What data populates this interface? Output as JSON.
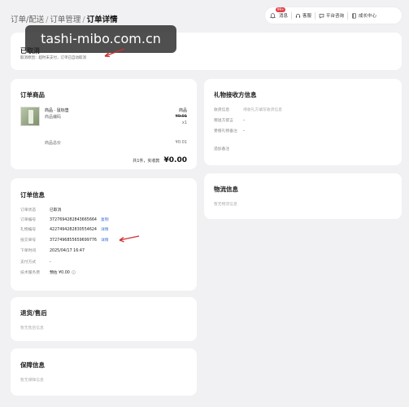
{
  "watermark": "tashi-mibo.com.cn",
  "breadcrumb": {
    "item1": "订单/配送",
    "item2": "订单管理",
    "current": "订单详情"
  },
  "topbar": {
    "bell_badge": "99+",
    "bell_label": "消息",
    "service_label": "客服",
    "consult_label": "平台咨询",
    "growth_label": "成长中心"
  },
  "status": {
    "title": "已取消",
    "note": "取消原因：超时未支付，订单已自动取消"
  },
  "product": {
    "section_title": "订单商品",
    "name": "商品 · 鼠标垫",
    "code_label": "商品编码",
    "price_label": "商品",
    "price": "¥0.01",
    "qty": "x1",
    "total_label": "商品总价",
    "total": "¥0.01",
    "summary_prefix": "共1件，实收款",
    "summary_amount": "¥0.00"
  },
  "gift": {
    "section_title": "礼物接收方信息",
    "rows": [
      {
        "key": "收货信息",
        "value": "待收礼方填写收货信息"
      },
      {
        "key": "赠送方留言",
        "value": "-"
      },
      {
        "key": "受赠礼物备注",
        "value": "-"
      },
      {
        "key": "追加备注",
        "value": ""
      }
    ]
  },
  "order_info": {
    "section_title": "订单信息",
    "rows": [
      {
        "key": "订单状态",
        "value": "已取消",
        "link": ""
      },
      {
        "key": "订单编号",
        "value": "3727694282843665664",
        "link": "复制"
      },
      {
        "key": "礼物编号",
        "value": "4227494282830554624",
        "link": "详情"
      },
      {
        "key": "抵交单号",
        "value": "3727496855659699776",
        "link": "详情"
      },
      {
        "key": "下单时间",
        "value": "2025/04/17 16:47",
        "link": ""
      },
      {
        "key": "支付方式",
        "value": "-",
        "link": ""
      },
      {
        "key": "技术服务费",
        "value": "预估 ¥0.00",
        "link": ""
      }
    ]
  },
  "logistics": {
    "section_title": "物流信息",
    "empty": "暂无物流信息"
  },
  "refund": {
    "section_title": "退货/售后",
    "empty": "暂无售后信息"
  },
  "guarantee": {
    "section_title": "保障信息",
    "empty": "暂无保障信息"
  }
}
